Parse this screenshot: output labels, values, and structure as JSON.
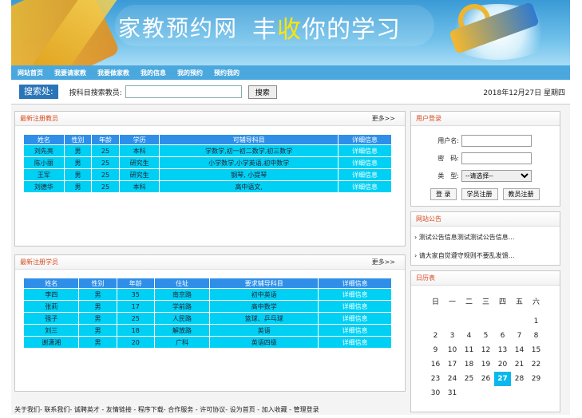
{
  "banner": {
    "title1": "家教预约网",
    "title2_a": "丰",
    "title2_hl": "收",
    "title2_b": "你的学习"
  },
  "nav": [
    "网站首页",
    "我要请家教",
    "我要做家教",
    "我的信息",
    "我的预约",
    "预约我的"
  ],
  "search": {
    "label": "搜索处:",
    "prompt": "按科目搜索教员:",
    "value": "",
    "button": "搜索",
    "date": "2018年12月27日 星期四"
  },
  "teachers": {
    "title": "最新注册教员",
    "more": "更多>>",
    "headers": [
      "姓名",
      "性别",
      "年龄",
      "学历",
      "可辅导科目",
      "详细信息"
    ],
    "rows": [
      [
        "刘先亮",
        "男",
        "25",
        "本科",
        "学数学,初一初二数学,初三数学",
        "详细信息"
      ],
      [
        "陈小丽",
        "男",
        "25",
        "研究生",
        "小学数学,小学英语,初中数学",
        "详细信息"
      ],
      [
        "王军",
        "男",
        "25",
        "研究生",
        "钢琴, 小提琴",
        "详细信息"
      ],
      [
        "刘德华",
        "男",
        "25",
        "本科",
        "高中语文,",
        "详细信息"
      ]
    ]
  },
  "students": {
    "title": "最新注册学员",
    "more": "更多>>",
    "headers": [
      "姓名",
      "性别",
      "年龄",
      "住址",
      "要求辅导科目",
      "详细信息"
    ],
    "rows": [
      [
        "李四",
        "男",
        "35",
        "南京路",
        "初中英语",
        "详细信息"
      ],
      [
        "张莉",
        "男",
        "17",
        "学前路",
        "高中数学",
        "详细信息"
      ],
      [
        "强子",
        "男",
        "25",
        "人民路",
        "篮球、乒乓球",
        "详细信息"
      ],
      [
        "刘三",
        "男",
        "18",
        "解放路",
        "英语",
        "详细信息"
      ],
      [
        "谢潇湘",
        "男",
        "20",
        "广科",
        "英语四级",
        "详细信息"
      ]
    ]
  },
  "login": {
    "title": "用户登录",
    "username_label": "用户名:",
    "password_label": "密　码:",
    "type_label": "类　型:",
    "type_value": "--请选择--",
    "login_btn": "登 录",
    "student_reg": "学员注册",
    "teacher_reg": "教员注册"
  },
  "notice": {
    "title": "网站公告",
    "items": [
      "测试公告信息测试测试公告信息...",
      "请大家自觉遵守规则不要乱发馈..."
    ]
  },
  "calendar": {
    "title": "日历表",
    "weekdays": [
      "日",
      "一",
      "二",
      "三",
      "四",
      "五",
      "六"
    ],
    "weeks": [
      [
        "",
        "",
        "",
        "",
        "",
        "",
        "1"
      ],
      [
        "2",
        "3",
        "4",
        "5",
        "6",
        "7",
        "8"
      ],
      [
        "9",
        "10",
        "11",
        "12",
        "13",
        "14",
        "15"
      ],
      [
        "16",
        "17",
        "18",
        "19",
        "20",
        "21",
        "22"
      ],
      [
        "23",
        "24",
        "25",
        "26",
        "27",
        "28",
        "29"
      ],
      [
        "30",
        "31",
        "",
        "",
        "",
        "",
        ""
      ]
    ],
    "today": "27"
  },
  "footer": "关于我们- 联系我们- 诚聘英才 - 友情链接 - 程序下载- 合作服务 - 许可协议- 设为首页 - 加入收藏 - 管理登录"
}
